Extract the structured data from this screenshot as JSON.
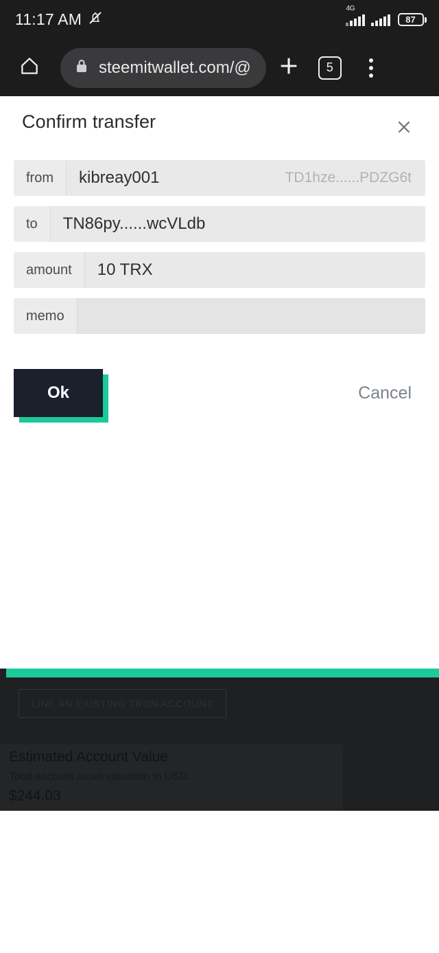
{
  "status_bar": {
    "clock": "11:17 AM",
    "mute_icon": "bell-muted-icon",
    "network_type": "4G",
    "signal_icon": "signal-bars-icon",
    "signal2_icon": "signal-bars-icon",
    "battery_level": "87"
  },
  "browser": {
    "home_icon": "home-icon",
    "lock_icon": "lock-icon",
    "url": "steemitwallet.com/@",
    "new_tab_icon": "plus-icon",
    "tab_count": "5",
    "menu_icon": "kebab-menu-icon"
  },
  "dialog": {
    "title": "Confirm transfer",
    "close_icon": "close-icon",
    "rows": [
      {
        "label": "from",
        "value": "kibreay001",
        "ghost": "TD1hze......PDZG6t"
      },
      {
        "label": "to",
        "value": "TN86py......wcVLdb",
        "ghost": ""
      },
      {
        "label": "amount",
        "value": "10  TRX",
        "ghost": ""
      },
      {
        "label": "memo",
        "value": "",
        "ghost": ""
      }
    ],
    "ok_label": "Ok",
    "cancel_label": "Cancel"
  },
  "bottom": {
    "link_account_label": "LINK AN EXISTING TRON ACCOUNT",
    "account_value_title": "Estimated Account Value",
    "account_value_sub": "Total account asset valuation in USD.",
    "account_value_amount": "$244.03"
  },
  "colors": {
    "accent_teal": "#1bc99a",
    "button_dark": "#1a202c",
    "chrome_dark": "#1c1c1c",
    "field_grey": "#e9e9e9"
  }
}
